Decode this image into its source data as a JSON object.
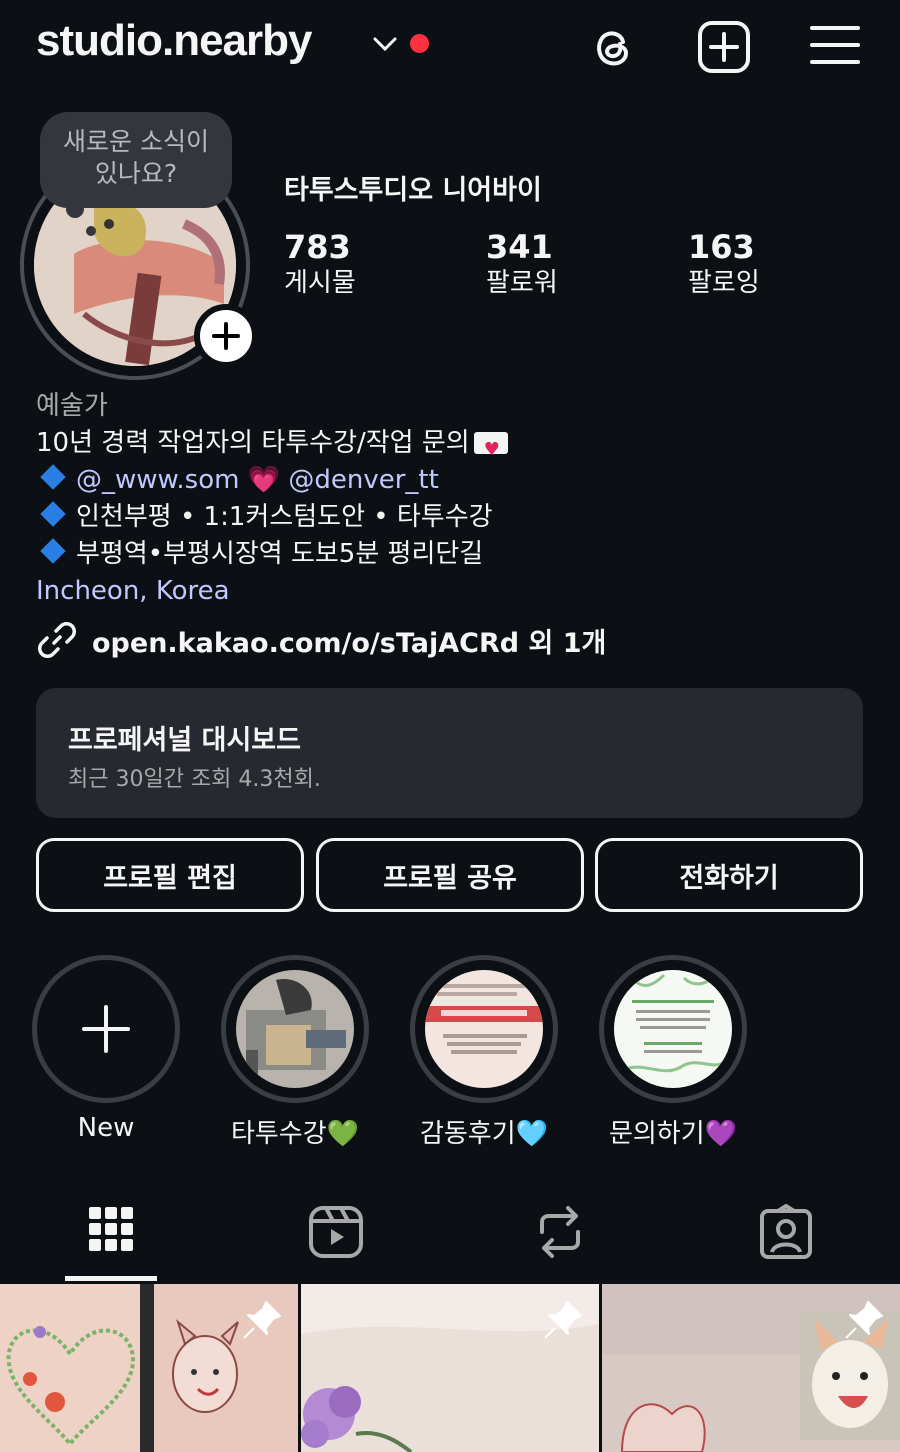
{
  "header": {
    "username": "studio.nearby",
    "icons": [
      "threads-icon",
      "create-icon",
      "menu-icon"
    ]
  },
  "note": {
    "text_line1": "새로운 소식이",
    "text_line2": "있나요?"
  },
  "profile": {
    "full_name": "타투스투디오 니어바이",
    "stats": [
      {
        "value": "783",
        "label": "게시물"
      },
      {
        "value": "341",
        "label": "팔로워"
      },
      {
        "value": "163",
        "label": "팔로잉"
      }
    ]
  },
  "bio": {
    "category": "예술가",
    "line1": "10년 경력 작업자의 타투수강/작업 문의",
    "mention1": "@_www.som",
    "mention2": "@denver_tt",
    "line3": "인천부평 • 1:1커스텀도안 • 타투수강",
    "line4": "부평역•부평시장역 도보5분 평리단길",
    "location": "Incheon, Korea",
    "external_link": "open.kakao.com/o/sTajACRd 외 1개"
  },
  "dashboard": {
    "title": "프로페셔널 대시보드",
    "subtitle": "최근 30일간 조회 4.3천회."
  },
  "buttons": {
    "edit": "프로필 편집",
    "share": "프로필 공유",
    "call": "전화하기"
  },
  "highlights": [
    {
      "label": "New"
    },
    {
      "label": "타투수강💚"
    },
    {
      "label": "감동후기🩵"
    },
    {
      "label": "문의하기💜"
    }
  ],
  "tabs": [
    "grid-icon",
    "reels-icon",
    "reposts-icon",
    "tagged-icon"
  ],
  "colors": {
    "background": "#0c1014",
    "accent_red": "#ff3040",
    "link": "#c2c8ff",
    "card": "#262a30"
  }
}
